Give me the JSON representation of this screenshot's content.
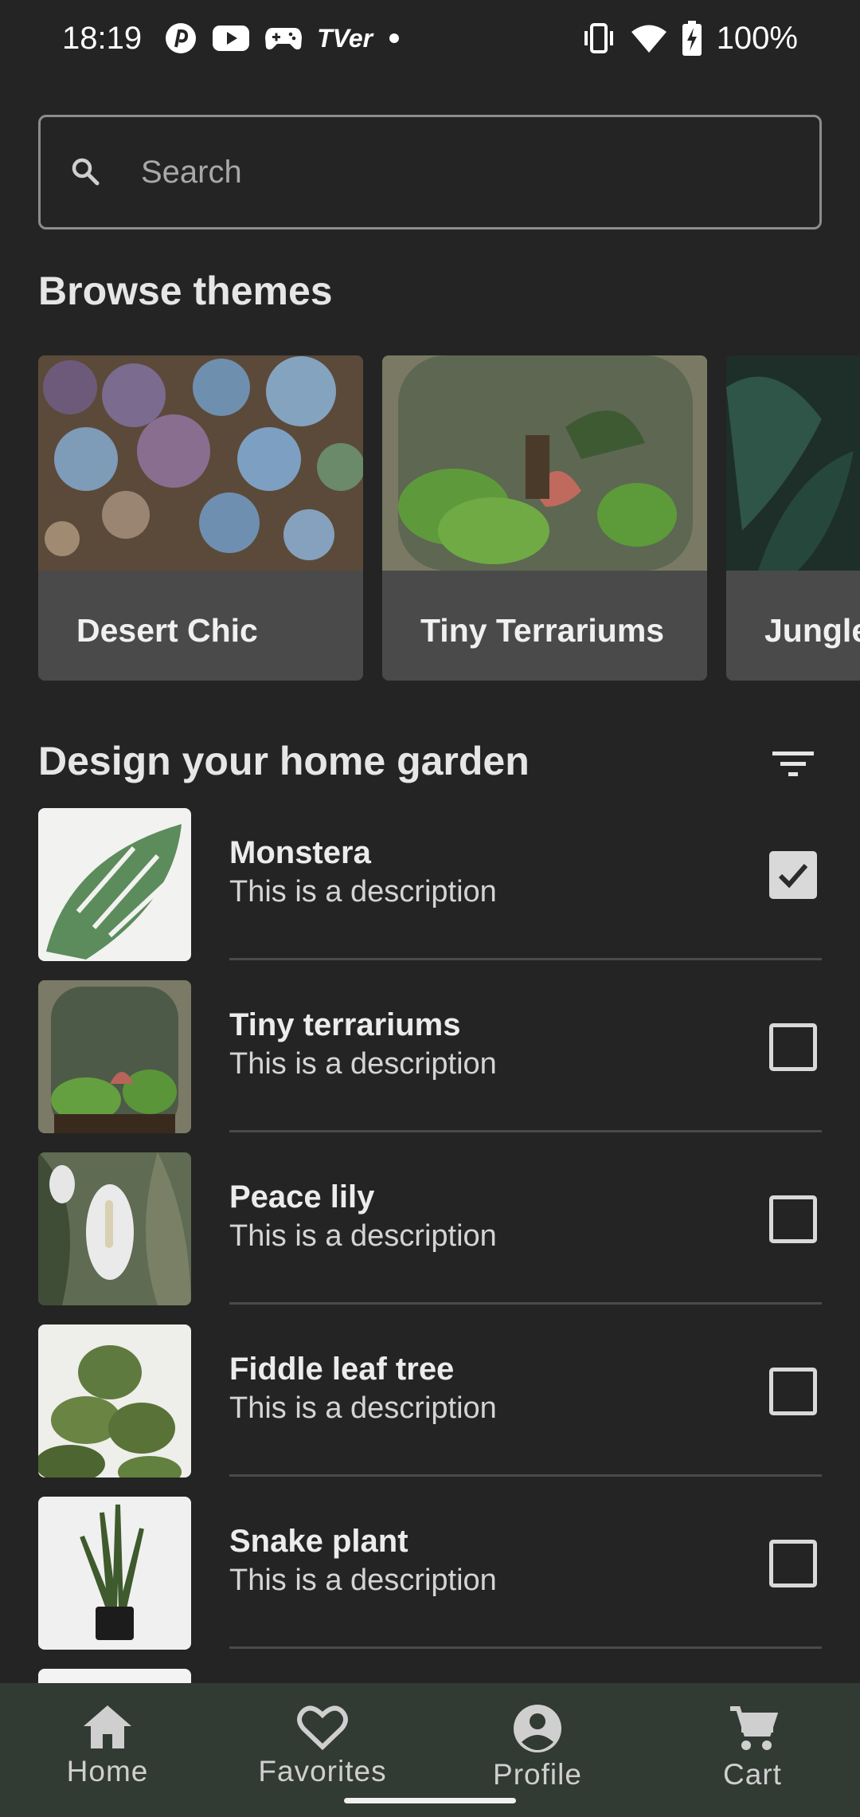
{
  "status_bar": {
    "time": "18:19",
    "app_icons": [
      "pinterest-like-icon",
      "youtube-icon",
      "gamepad-icon",
      "tver-icon",
      "dot-icon"
    ],
    "tver_text": "TVer",
    "battery_text": "100%"
  },
  "search": {
    "placeholder": "Search",
    "value": ""
  },
  "themes_section": {
    "heading": "Browse themes",
    "items": [
      {
        "label": "Desert Chic"
      },
      {
        "label": "Tiny Terrariums"
      },
      {
        "label": "Jungle Vibes"
      }
    ]
  },
  "garden_section": {
    "heading": "Design your home garden",
    "filter_icon": "filter-list-icon",
    "items": [
      {
        "name": "Monstera",
        "description": "This is a description",
        "checked": true
      },
      {
        "name": "Tiny terrariums",
        "description": "This is a description",
        "checked": false
      },
      {
        "name": "Peace lily",
        "description": "This is a description",
        "checked": false
      },
      {
        "name": "Fiddle leaf tree",
        "description": "This is a description",
        "checked": false
      },
      {
        "name": "Snake plant",
        "description": "This is a description",
        "checked": false
      }
    ]
  },
  "bottom_nav": {
    "items": [
      {
        "label": "Home",
        "icon": "home-icon"
      },
      {
        "label": "Favorites",
        "icon": "heart-icon"
      },
      {
        "label": "Profile",
        "icon": "account-circle-icon"
      },
      {
        "label": "Cart",
        "icon": "cart-icon"
      }
    ]
  },
  "colors": {
    "background": "#242424",
    "card": "#4a4a4a",
    "nav_background": "#323a34",
    "checkbox": "#d9d9d9"
  }
}
